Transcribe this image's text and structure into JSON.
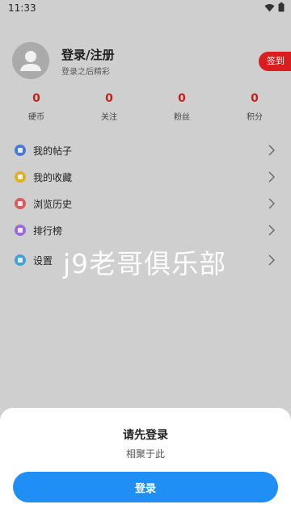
{
  "status_bar": {
    "time": "11:33"
  },
  "profile": {
    "title": "登录/注册",
    "subtitle": "登录之后精彩",
    "checkin_label": "签到"
  },
  "stats": [
    {
      "value": "0",
      "label": "硬币"
    },
    {
      "value": "0",
      "label": "关注"
    },
    {
      "value": "0",
      "label": "粉丝"
    },
    {
      "value": "0",
      "label": "积分"
    }
  ],
  "menu": [
    {
      "label": "我的帖子",
      "icon": "posts-icon",
      "color": "#4a78d6"
    },
    {
      "label": "我的收藏",
      "icon": "star-icon",
      "color": "#e0b020"
    },
    {
      "label": "浏览历史",
      "icon": "history-icon",
      "color": "#d85c5c"
    },
    {
      "label": "排行榜",
      "icon": "crown-icon",
      "color": "#9c6bd8"
    },
    {
      "label": "设置",
      "icon": "gear-icon",
      "color": "#3fa3d8"
    }
  ],
  "watermark": "j9老哥俱乐部",
  "login_sheet": {
    "title": "请先登录",
    "subtitle": "相聚于此",
    "button_label": "登录"
  },
  "colors": {
    "accent_red": "#d81e1e",
    "stat_red": "#c82020",
    "button_blue": "#1f8ff5"
  }
}
